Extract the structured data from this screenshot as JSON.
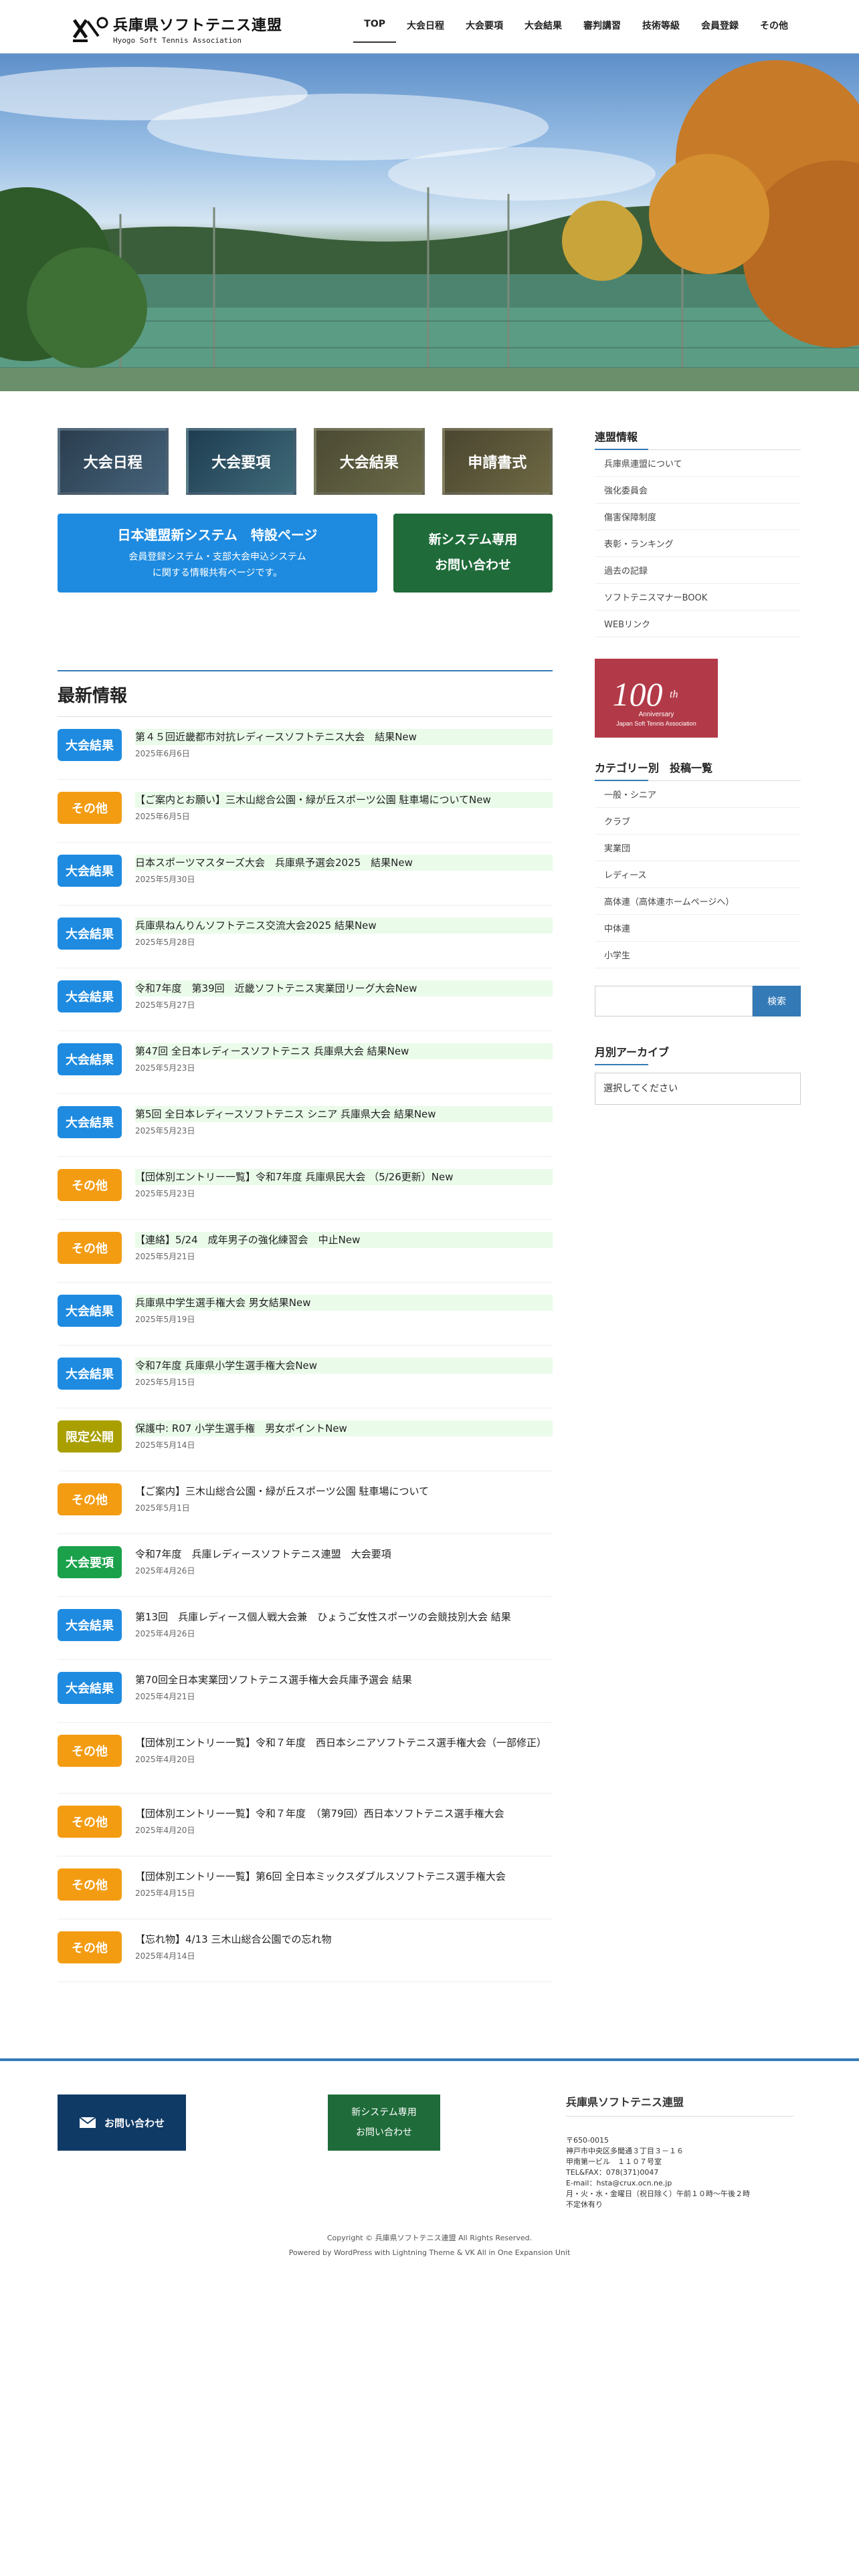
{
  "header": {
    "logo_title": "兵庫県ソフトテニス連盟",
    "logo_sub": "Hyogo Soft Tennis Association",
    "nav": [
      "TOP",
      "大会日程",
      "大会要項",
      "大会結果",
      "審判講習",
      "技術等級",
      "会員登録",
      "その他"
    ]
  },
  "buttons": {
    "cats": [
      "大会日程",
      "大会要項",
      "大会結果",
      "申請書式"
    ],
    "promo_title": "日本連盟新システム　特設ページ",
    "promo_sub1": "会員登録システム・支部大会申込システム",
    "promo_sub2": "に関する情報共有ページです。",
    "promo_green1": "新システム専用",
    "promo_green2": "お問い合わせ"
  },
  "news": {
    "heading": "最新情報",
    "items": [
      {
        "badge": "大会結果",
        "title": "第４５回近畿都市対抗レディースソフトテニス大会　結果New",
        "date": "2025年6月6日",
        "new": true
      },
      {
        "badge": "その他",
        "title": "【ご案内とお願い】三木山総合公園・緑が丘スポーツ公園 駐車場についてNew",
        "date": "2025年6月5日",
        "new": true
      },
      {
        "badge": "大会結果",
        "title": "日本スポーツマスターズ大会　兵庫県予選会2025　結果New",
        "date": "2025年5月30日",
        "new": true
      },
      {
        "badge": "大会結果",
        "title": "兵庫県ねんりんソフトテニス交流大会2025 結果New",
        "date": "2025年5月28日",
        "new": true
      },
      {
        "badge": "大会結果",
        "title": "令和7年度　第39回　近畿ソフトテニス実業団リーグ大会New",
        "date": "2025年5月27日",
        "new": true
      },
      {
        "badge": "大会結果",
        "title": "第47回 全日本レディースソフトテニス 兵庫県大会 結果New",
        "date": "2025年5月23日",
        "new": true
      },
      {
        "badge": "大会結果",
        "title": "第5回 全日本レディースソフトテニス シニア 兵庫県大会 結果New",
        "date": "2025年5月23日",
        "new": true
      },
      {
        "badge": "その他",
        "title": "【団体別エントリー一覧】令和7年度 兵庫県民大会 （5/26更新）New",
        "date": "2025年5月23日",
        "new": true
      },
      {
        "badge": "その他",
        "title": "【連絡】5/24　成年男子の強化練習会　中止New",
        "date": "2025年5月21日",
        "new": true
      },
      {
        "badge": "大会結果",
        "title": "兵庫県中学生選手権大会 男女結果New",
        "date": "2025年5月19日",
        "new": true
      },
      {
        "badge": "大会結果",
        "title": "令和7年度 兵庫県小学生選手権大会New",
        "date": "2025年5月15日",
        "new": true
      },
      {
        "badge": "限定公開",
        "title": "保護中: R07 小学生選手権　男女ポイントNew",
        "date": "2025年5月14日",
        "new": true
      },
      {
        "badge": "その他",
        "title": "【ご案内】三木山総合公園・緑が丘スポーツ公園 駐車場について",
        "date": "2025年5月1日",
        "new": false
      },
      {
        "badge": "大会要項",
        "title": "令和7年度　兵庫レディースソフトテニス連盟　大会要項",
        "date": "2025年4月26日",
        "new": false
      },
      {
        "badge": "大会結果",
        "title": "第13回　兵庫レディース個人戦大会兼　ひょうご女性スポーツの会競技別大会 結果",
        "date": "2025年4月26日",
        "new": false
      },
      {
        "badge": "大会結果",
        "title": "第70回全日本実業団ソフトテニス選手権大会兵庫予選会 結果",
        "date": "2025年4月21日",
        "new": false
      },
      {
        "badge": "その他",
        "title": "【団体別エントリー一覧】令和７年度　西日本シニアソフトテニス選手権大会（一部修正）",
        "date": "2025年4月20日",
        "new": false
      },
      {
        "badge": "その他",
        "title": "【団体別エントリー一覧】令和７年度　（第79回）西日本ソフトテニス選手権大会",
        "date": "2025年4月20日",
        "new": false
      },
      {
        "badge": "その他",
        "title": "【団体別エントリー一覧】第6回 全日本ミックスダブルスソフトテニス選手権大会",
        "date": "2025年4月15日",
        "new": false
      },
      {
        "badge": "その他",
        "title": "【忘れ物】4/13 三木山総合公園での忘れ物",
        "date": "2025年4月14日",
        "new": false
      }
    ]
  },
  "badge_colors": {
    "大会結果": "#1e8be0",
    "その他": "#f39c12",
    "限定公開": "#a9a000",
    "大会要項": "#1aa14a"
  },
  "sidebar": {
    "info_heading": "連盟情報",
    "info_links": [
      "兵庫県連盟について",
      "強化委員会",
      "傷害保障制度",
      "表彰・ランキング",
      "過去の記録",
      "ソフトテニスマナーBOOK",
      "WEBリンク"
    ],
    "badge_num": "100",
    "badge_th": "th",
    "badge_ann": "Anniversary",
    "badge_org": "Japan Soft Tennis Association",
    "cat_heading": "カテゴリー別　投稿一覧",
    "cat_links": [
      "一般・シニア",
      "クラブ",
      "実業団",
      "レディース",
      "高体連（高体連ホームページへ）",
      "中体連",
      "小学生"
    ],
    "search_button": "検索",
    "archive_heading": "月別アーカイブ",
    "archive_select": "選択してください"
  },
  "footer": {
    "contact": "お問い合わせ",
    "sys1": "新システム専用",
    "sys2": "お問い合わせ",
    "org_name": "兵庫県ソフトテニス連盟",
    "addr": [
      "〒650-0015",
      "神戸市中央区多聞通３丁目３－１６",
      "甲南第一ビル　１１０７号室",
      "TEL&FAX：078(371)0047",
      "E-mail：hsta@crux.ocn.ne.jp",
      "月・火・水・金曜日（祝日除く）午前１０時～午後２時",
      "不定休有り"
    ],
    "copyright": "Copyright © 兵庫県ソフトテニス連盟 All Rights Reserved.",
    "powered": "Powered by WordPress with Lightning Theme & VK All in One Expansion Unit"
  }
}
